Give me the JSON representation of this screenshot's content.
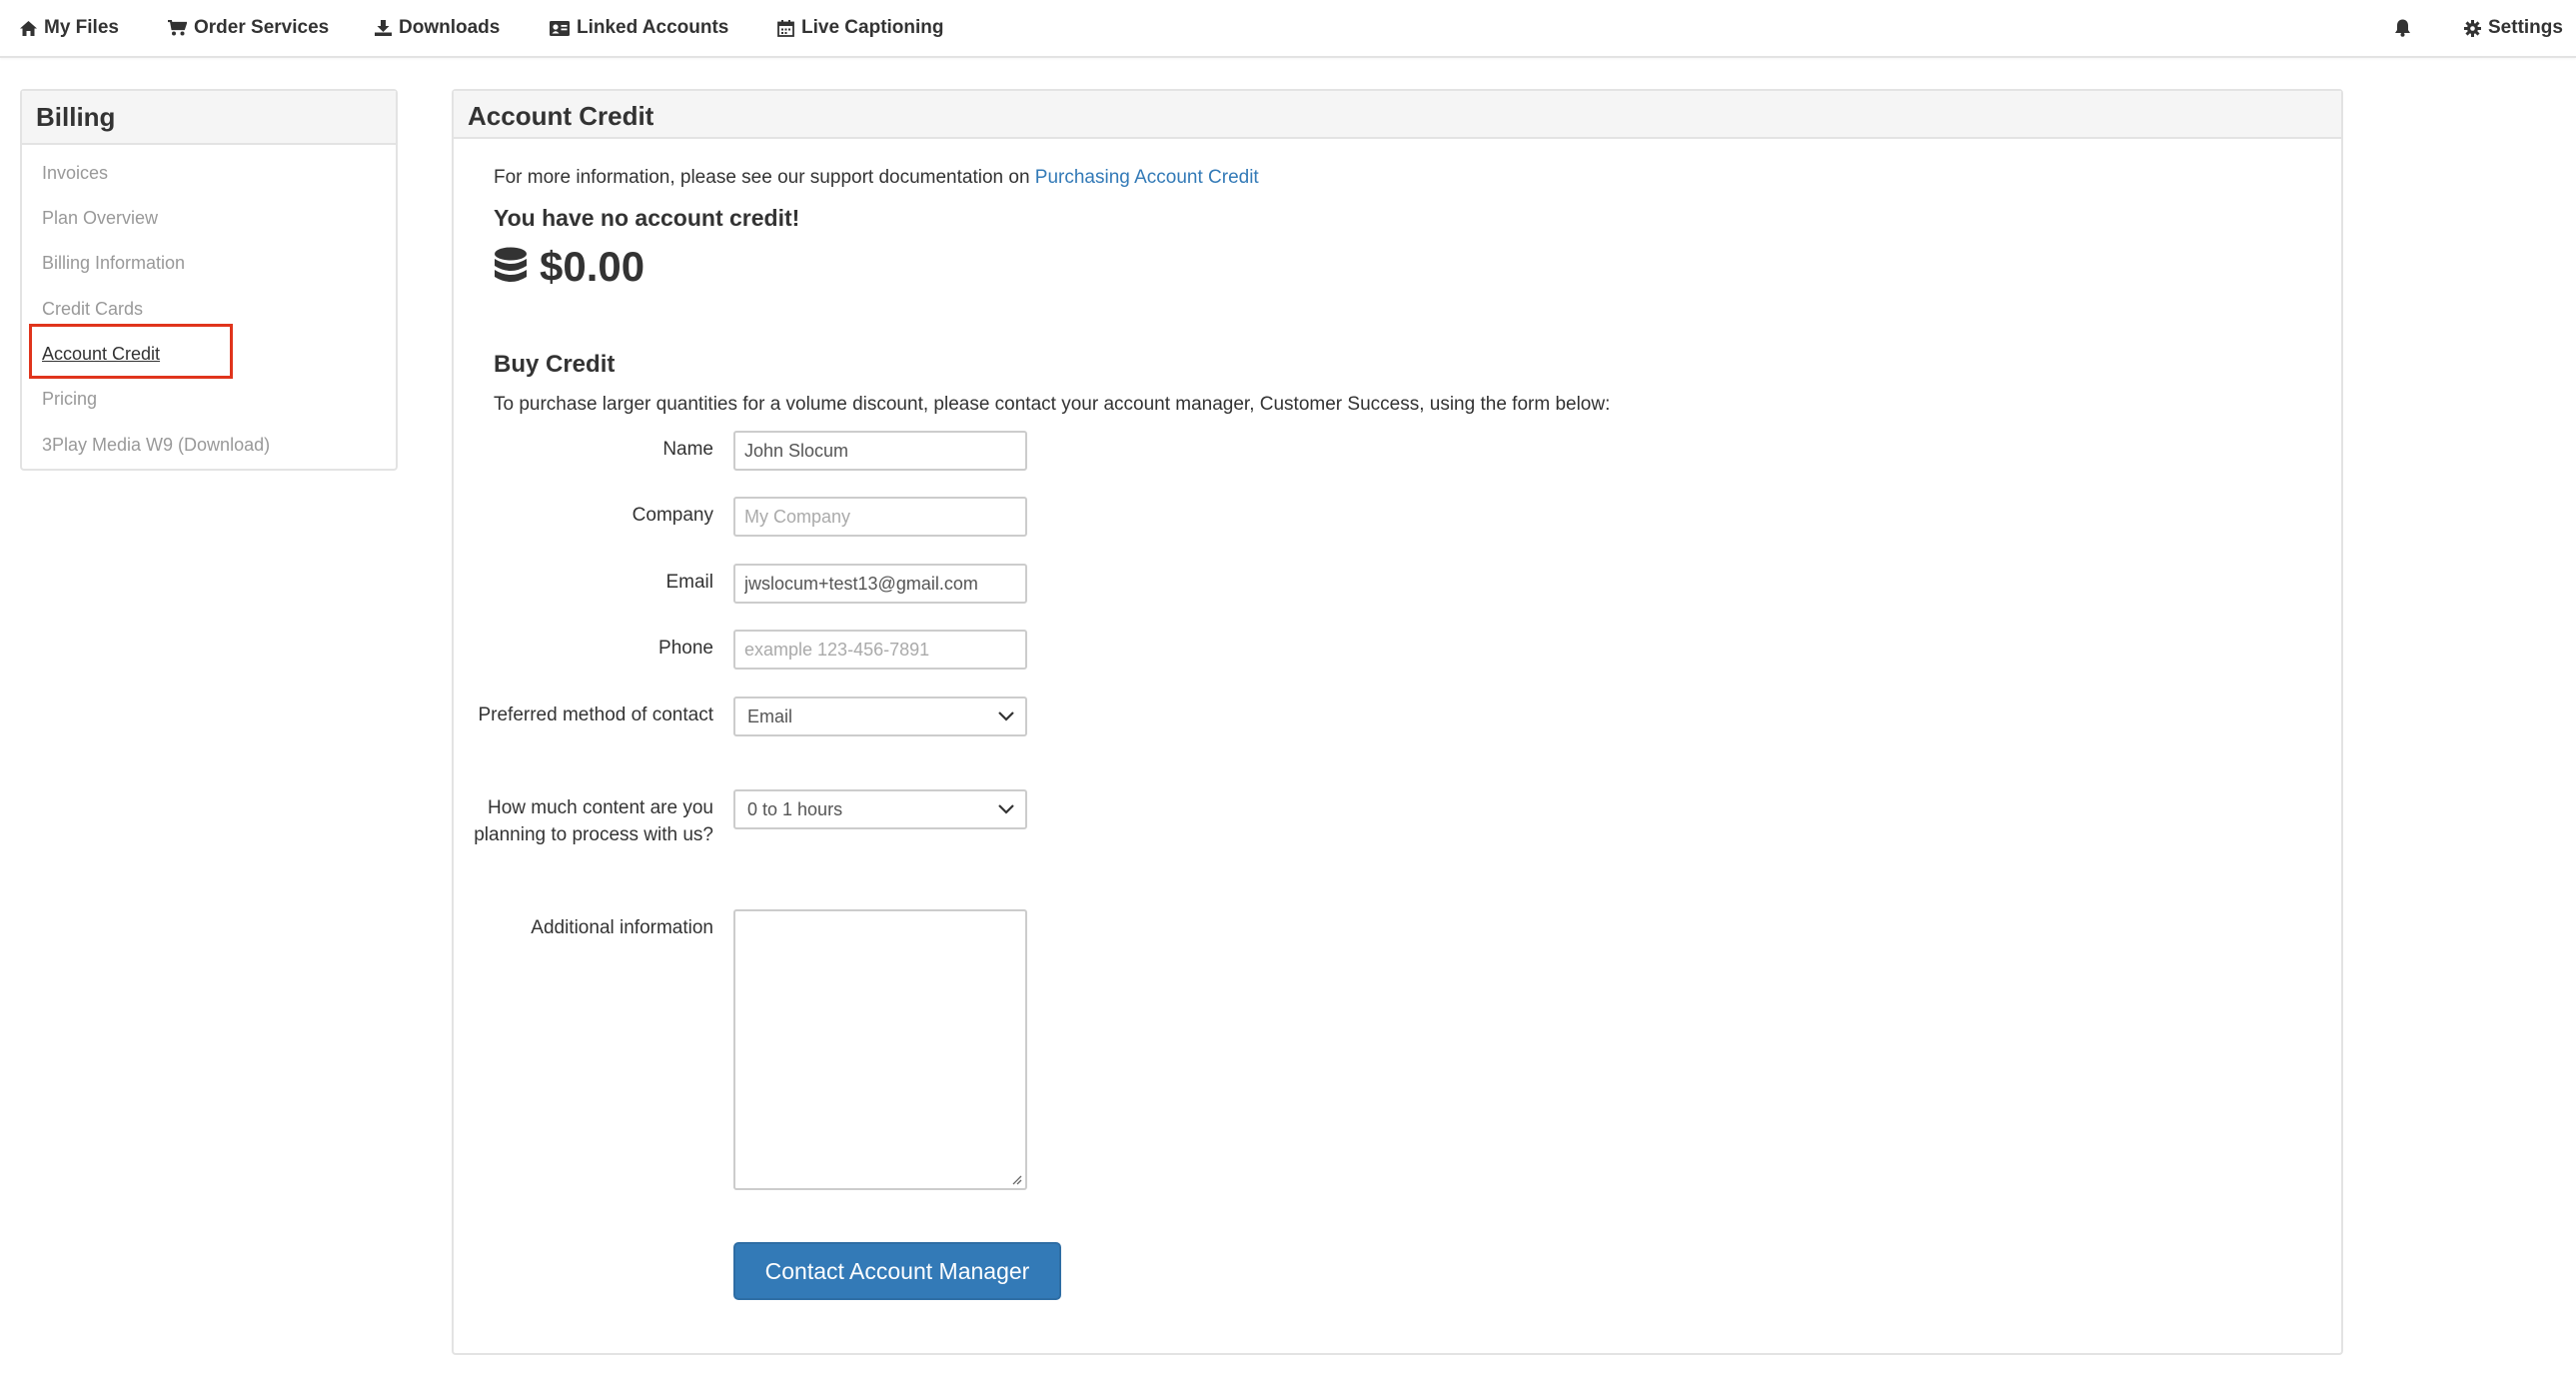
{
  "nav": {
    "my_files": "My Files",
    "order_services": "Order Services",
    "downloads": "Downloads",
    "linked_accounts": "Linked Accounts",
    "live_captioning": "Live Captioning",
    "settings": "Settings"
  },
  "sidebar": {
    "title": "Billing",
    "items": [
      {
        "label": "Invoices"
      },
      {
        "label": "Plan Overview"
      },
      {
        "label": "Billing Information"
      },
      {
        "label": "Credit Cards"
      },
      {
        "label": "Account Credit",
        "active": true
      },
      {
        "label": "Pricing"
      },
      {
        "label": "3Play Media W9 (Download)"
      }
    ]
  },
  "main": {
    "title": "Account Credit",
    "info_prefix": "For more information, please see our support documentation on ",
    "info_link": "Purchasing Account Credit",
    "no_credit": "You have no account credit!",
    "balance": "$0.00",
    "buy_title": "Buy Credit",
    "buy_desc": "To purchase larger quantities for a volume discount, please contact your account manager, Customer Success, using the form below:"
  },
  "form": {
    "name": {
      "label": "Name",
      "value": "John Slocum",
      "placeholder": ""
    },
    "company": {
      "label": "Company",
      "value": "",
      "placeholder": "My Company"
    },
    "email": {
      "label": "Email",
      "value": "jwslocum+test13@gmail.com",
      "placeholder": ""
    },
    "phone": {
      "label": "Phone",
      "value": "",
      "placeholder": "example 123-456-7891"
    },
    "contact_method": {
      "label": "Preferred method of contact",
      "selected": "Email"
    },
    "content_amount": {
      "label": "How much content are you planning to process with us?",
      "selected": "0 to 1 hours"
    },
    "additional": {
      "label": "Additional information",
      "value": ""
    },
    "submit": "Contact Account Manager"
  },
  "colors": {
    "accent": "#337ab7",
    "highlight_box": "#e0341c"
  }
}
